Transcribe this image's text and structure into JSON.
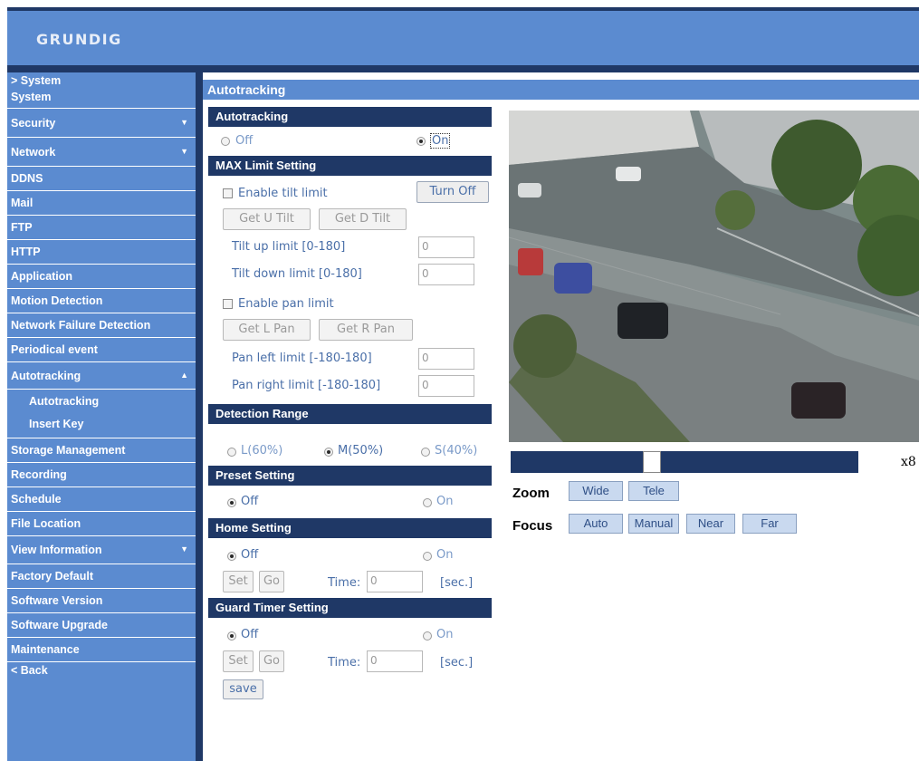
{
  "brand": {
    "logo_text": "GRUNDIG"
  },
  "sidebar": {
    "items": [
      {
        "label": "> System"
      },
      {
        "label": "System"
      },
      {
        "label": "Security",
        "arrow": "▼"
      },
      {
        "label": "Network",
        "arrow": "▼"
      },
      {
        "label": "DDNS"
      },
      {
        "label": "Mail"
      },
      {
        "label": "FTP"
      },
      {
        "label": "HTTP"
      },
      {
        "label": "Application"
      },
      {
        "label": "Motion Detection"
      },
      {
        "label": "Network Failure Detection"
      },
      {
        "label": "Periodical event"
      },
      {
        "label": "Autotracking",
        "arrow": "▲"
      },
      {
        "label": "Autotracking"
      },
      {
        "label": "Insert Key"
      },
      {
        "label": "Storage Management"
      },
      {
        "label": "Recording"
      },
      {
        "label": "Schedule"
      },
      {
        "label": "File Location"
      },
      {
        "label": "View Information",
        "arrow": "▼"
      },
      {
        "label": "Factory Default"
      },
      {
        "label": "Software Version"
      },
      {
        "label": "Software Upgrade"
      },
      {
        "label": "Maintenance"
      },
      {
        "label": "< Back"
      }
    ]
  },
  "page": {
    "title": "Autotracking"
  },
  "autotracking": {
    "section_title": "Autotracking",
    "off_label": "Off",
    "on_label": "On",
    "selected": "On"
  },
  "max_limit": {
    "section_title": "MAX Limit Setting",
    "enable_tilt_label": "Enable tilt limit",
    "turn_off_label": "Turn Off",
    "get_u_tilt_label": "Get U Tilt",
    "get_d_tilt_label": "Get D Tilt",
    "tilt_up_label": "Tilt up limit [0-180]",
    "tilt_up_value": "0",
    "tilt_down_label": "Tilt down limit [0-180]",
    "tilt_down_value": "0",
    "enable_pan_label": "Enable pan limit",
    "get_l_pan_label": "Get L Pan",
    "get_r_pan_label": "Get R Pan",
    "pan_left_label": "Pan left limit [-180-180]",
    "pan_left_value": "0",
    "pan_right_label": "Pan right limit [-180-180]",
    "pan_right_value": "0"
  },
  "detection_range": {
    "section_title": "Detection Range",
    "options": [
      "L(60%)",
      "M(50%)",
      "S(40%)"
    ],
    "selected": "M(50%)"
  },
  "preset": {
    "section_title": "Preset Setting",
    "off_label": "Off",
    "on_label": "On",
    "selected": "Off"
  },
  "home": {
    "section_title": "Home Setting",
    "off_label": "Off",
    "on_label": "On",
    "selected": "Off",
    "set_label": "Set",
    "go_label": "Go",
    "time_label": "Time:",
    "time_value": "0",
    "unit_label": "[sec.]"
  },
  "guard": {
    "section_title": "Guard Timer Setting",
    "off_label": "Off",
    "on_label": "On",
    "selected": "Off",
    "set_label": "Set",
    "go_label": "Go",
    "time_label": "Time:",
    "time_value": "0",
    "unit_label": "[sec.]"
  },
  "save_label": "save",
  "camera": {
    "zoom_level_text": "x8",
    "zoom_slider_fraction": 0.4,
    "zoom_label": "Zoom",
    "wide_label": "Wide",
    "tele_label": "Tele",
    "focus_label": "Focus",
    "auto_label": "Auto",
    "manual_label": "Manual",
    "near_label": "Near",
    "far_label": "Far"
  },
  "colors": {
    "accent": "#5b8bd0",
    "dark_navy": "#1f3866",
    "label_blue": "#4a6fa8"
  }
}
